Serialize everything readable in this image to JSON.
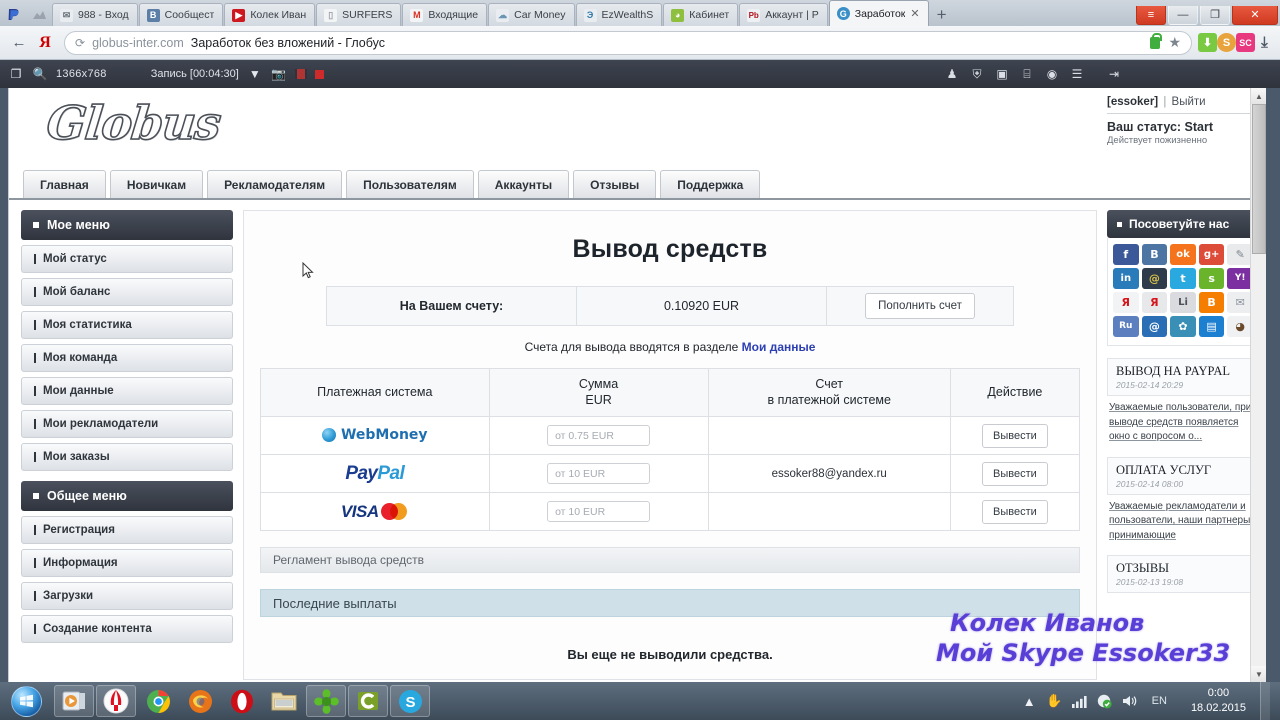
{
  "browser": {
    "tabs": [
      {
        "label": "988 - Вход",
        "favicon": "mail-icon",
        "color": "#cfd6de",
        "active": false
      },
      {
        "label": "Сообщест",
        "favicon": "vk-icon",
        "color": "#5b7fa6",
        "active": false
      },
      {
        "label": "Колек Иван",
        "favicon": "youtube-icon",
        "color": "#cc181e",
        "active": false
      },
      {
        "label": "SURFERS",
        "favicon": "page-icon",
        "color": "#dfe3e7",
        "active": false
      },
      {
        "label": "Входящие",
        "favicon": "gmail-icon",
        "color": "#d93025",
        "active": false
      },
      {
        "label": "Car Money",
        "favicon": "cloud-icon",
        "color": "#8fa6b8",
        "active": false
      },
      {
        "label": "EzWealthS",
        "favicon": "ez-icon",
        "color": "#3b7a9e",
        "active": false
      },
      {
        "label": "Кабинет",
        "favicon": "leaf-icon",
        "color": "#8fbf3f",
        "active": false
      },
      {
        "label": "Аккаунт | P",
        "favicon": "pb-icon",
        "color": "#b5121b",
        "active": false
      },
      {
        "label": "Заработок",
        "favicon": "globus-icon",
        "color": "#3a8fc7",
        "active": true
      }
    ],
    "tab_close_glyph": "✕",
    "newtab_label": "+",
    "window_buttons": {
      "menu": "≡",
      "minimize": "—",
      "maximize": "❐",
      "close": "✕"
    },
    "back_glyph": "←",
    "yandex_glyph": "Я",
    "reload_glyph": "⟳",
    "url_domain": "globus-inter.com",
    "url_title": "Заработок без вложений - Глобус",
    "star_glyph": "★",
    "extensions": [
      {
        "name": "download-icon",
        "glyph": "⬇",
        "color": "#7ac943"
      },
      {
        "name": "money-extension-icon",
        "glyph": "S",
        "color": "#e8a33d"
      },
      {
        "name": "sc-extension-icon",
        "glyph": "SC",
        "color": "#e8387f"
      },
      {
        "name": "downloads-icon",
        "glyph": "⤓",
        "color": "#5a6470"
      }
    ]
  },
  "recorder": {
    "window_icon": "window-icon",
    "search_icon": "magnifier-icon",
    "resolution": "1366x768",
    "status": "Запись [00:04:30]",
    "dropdown_glyph": "▼",
    "camera_icon": "camera-icon",
    "pause_icon": "pause-icon",
    "stop_icon": "stop-record-icon",
    "right_icons": [
      {
        "name": "user-icon",
        "glyph": "♟"
      },
      {
        "name": "shield-icon",
        "glyph": "⛨"
      },
      {
        "name": "monitor-icon",
        "glyph": "▣"
      },
      {
        "name": "calculator-icon",
        "glyph": "⌸"
      },
      {
        "name": "globe-icon",
        "glyph": "◉"
      },
      {
        "name": "notebook-icon",
        "glyph": "☰"
      },
      {
        "name": "exit-icon",
        "glyph": "⇥"
      }
    ]
  },
  "site": {
    "logo_text": "Globus",
    "user": {
      "name": "[essoker]",
      "separator": "|",
      "logout": "Выйти",
      "status": "Ваш статус: Start",
      "status_note": "Действует пожизненно"
    },
    "nav": [
      {
        "label": "Главная"
      },
      {
        "label": "Новичкам"
      },
      {
        "label": "Рекламодателям"
      },
      {
        "label": "Пользователям"
      },
      {
        "label": "Аккаунты"
      },
      {
        "label": "Отзывы"
      },
      {
        "label": "Поддержка"
      }
    ]
  },
  "sidebar_left": {
    "menus": [
      {
        "title": "Мое меню",
        "items": [
          {
            "label": "Мой статус"
          },
          {
            "label": "Мой баланс"
          },
          {
            "label": "Моя статистика"
          },
          {
            "label": "Моя команда"
          },
          {
            "label": "Мои данные"
          },
          {
            "label": "Мои рекламодатели"
          },
          {
            "label": "Мои заказы"
          }
        ]
      },
      {
        "title": "Общее меню",
        "items": [
          {
            "label": "Регистрация"
          },
          {
            "label": "Информация"
          },
          {
            "label": "Загрузки"
          },
          {
            "label": "Создание контента"
          }
        ]
      }
    ]
  },
  "main": {
    "title": "Вывод средств",
    "balance": {
      "label": "На Вашем счету:",
      "value": "0.10920 EUR",
      "topup_button": "Пополнить счет"
    },
    "hint_prefix": "Счета для вывода вводятся в разделе ",
    "hint_link": "Мои данные",
    "table": {
      "headers": {
        "system": "Платежная система",
        "amount_line1": "Сумма",
        "amount_line2": "EUR",
        "account_line1": "Счет",
        "account_line2": "в платежной системе",
        "action": "Действие"
      },
      "rows": [
        {
          "system": "WebMoney",
          "system_icon": "webmoney-logo",
          "amount_placeholder": "от 0.75 EUR",
          "amount_value": "",
          "account": "",
          "action": "Вывести"
        },
        {
          "system": "PayPal",
          "system_icon": "paypal-logo",
          "amount_placeholder": "от 10 EUR",
          "amount_value": "",
          "account": "essoker88@yandex.ru",
          "action": "Вывести"
        },
        {
          "system": "VISA MasterCard",
          "system_icon": "visa-mastercard-logo",
          "amount_placeholder": "от 10 EUR",
          "amount_value": "",
          "account": "",
          "action": "Вывести"
        }
      ]
    },
    "rules_panel": "Регламент вывода средств",
    "payouts_panel": "Последние выплаты",
    "payouts_empty": "Вы еще не выводили средства."
  },
  "sidebar_right": {
    "title": "Посоветуйте нас",
    "social": [
      {
        "name": "facebook-icon",
        "glyph": "f",
        "color": "#3b5998"
      },
      {
        "name": "vk-icon",
        "glyph": "B",
        "color": "#4c75a3"
      },
      {
        "name": "odnoklassniki-icon",
        "glyph": "ok",
        "color": "#f4731c"
      },
      {
        "name": "google-plus-icon",
        "glyph": "g+",
        "color": "#dd4b39"
      },
      {
        "name": "liveinternet-icon",
        "glyph": "✎",
        "color": "#e8eaec"
      },
      {
        "name": "linkedin-icon",
        "glyph": "in",
        "color": "#2a7bb9"
      },
      {
        "name": "livejournal-icon",
        "glyph": "@",
        "color": "#2d3b4a"
      },
      {
        "name": "twitter-icon",
        "glyph": "t",
        "color": "#2aa9e0"
      },
      {
        "name": "surfingbird-icon",
        "glyph": "s",
        "color": "#6ab42c"
      },
      {
        "name": "yahoo-icon",
        "glyph": "Y!",
        "color": "#7b2fa0"
      },
      {
        "name": "yandex-icon",
        "glyph": "Я",
        "color": "#f2f3f5"
      },
      {
        "name": "yaru-icon",
        "glyph": "Я",
        "color": "#e6e8ea"
      },
      {
        "name": "liveinternet-li-icon",
        "glyph": "Li",
        "color": "#d9dbde"
      },
      {
        "name": "blogger-icon",
        "glyph": "B",
        "color": "#f57d00"
      },
      {
        "name": "email-icon",
        "glyph": "✉",
        "color": "#eceef0"
      },
      {
        "name": "webmoney-icon",
        "glyph": "Ru",
        "color": "#5b7fbf"
      },
      {
        "name": "mail-ru-icon",
        "glyph": "@",
        "color": "#2a6fb5"
      },
      {
        "name": "flower-icon",
        "glyph": "✿",
        "color": "#3a8fb7"
      },
      {
        "name": "squares-icon",
        "glyph": "▤",
        "color": "#1c7fd0"
      },
      {
        "name": "beaver-icon",
        "glyph": "◕",
        "color": "#f0f1f3"
      }
    ],
    "news": [
      {
        "title": "ВЫВОД НА PAYPAL",
        "date": "2015-02-14 20:29",
        "text": "Уважаемые пользователи, при выводе средств появляется окно с вопросом о..."
      },
      {
        "title": "ОПЛАТА УСЛУГ",
        "date": "2015-02-14 08:00",
        "text": "Уважаемые рекламодатели и пользователи, наши партнеры, принимающие"
      },
      {
        "title": "ОТЗЫВЫ",
        "date": "2015-02-13 19:08",
        "text": ""
      }
    ]
  },
  "watermark": {
    "line1": "Колек Иванов",
    "line2": "Мой Skype Essoker33"
  },
  "taskbar": {
    "start_icon": "windows-start-orb",
    "items": [
      {
        "name": "media-player-icon",
        "glyph": "▶",
        "color": "#e8983a"
      },
      {
        "name": "yandex-browser-icon",
        "glyph": "Я",
        "color": "#e01020"
      },
      {
        "name": "chrome-icon",
        "glyph": "◉",
        "color": "#4caf50"
      },
      {
        "name": "firefox-icon",
        "glyph": "◉",
        "color": "#e8741a"
      },
      {
        "name": "opera-icon",
        "glyph": "O",
        "color": "#cc0f16"
      },
      {
        "name": "folder-icon",
        "glyph": "▤",
        "color": "#e8c766"
      },
      {
        "name": "icq-icon",
        "glyph": "✿",
        "color": "#5cbf2a"
      },
      {
        "name": "camtasia-icon",
        "glyph": "C",
        "color": "#7aa02a"
      },
      {
        "name": "skype-icon",
        "glyph": "S",
        "color": "#29a8e0"
      }
    ],
    "tray": {
      "expand_glyph": "▲",
      "icons": [
        {
          "name": "hand-icon",
          "glyph": "✋"
        },
        {
          "name": "network-signal-icon",
          "glyph": "█"
        },
        {
          "name": "security-icon",
          "glyph": "◐"
        },
        {
          "name": "volume-icon",
          "glyph": "◂"
        }
      ],
      "language": "EN",
      "time": "0:00",
      "date": "18.02.2015"
    }
  }
}
